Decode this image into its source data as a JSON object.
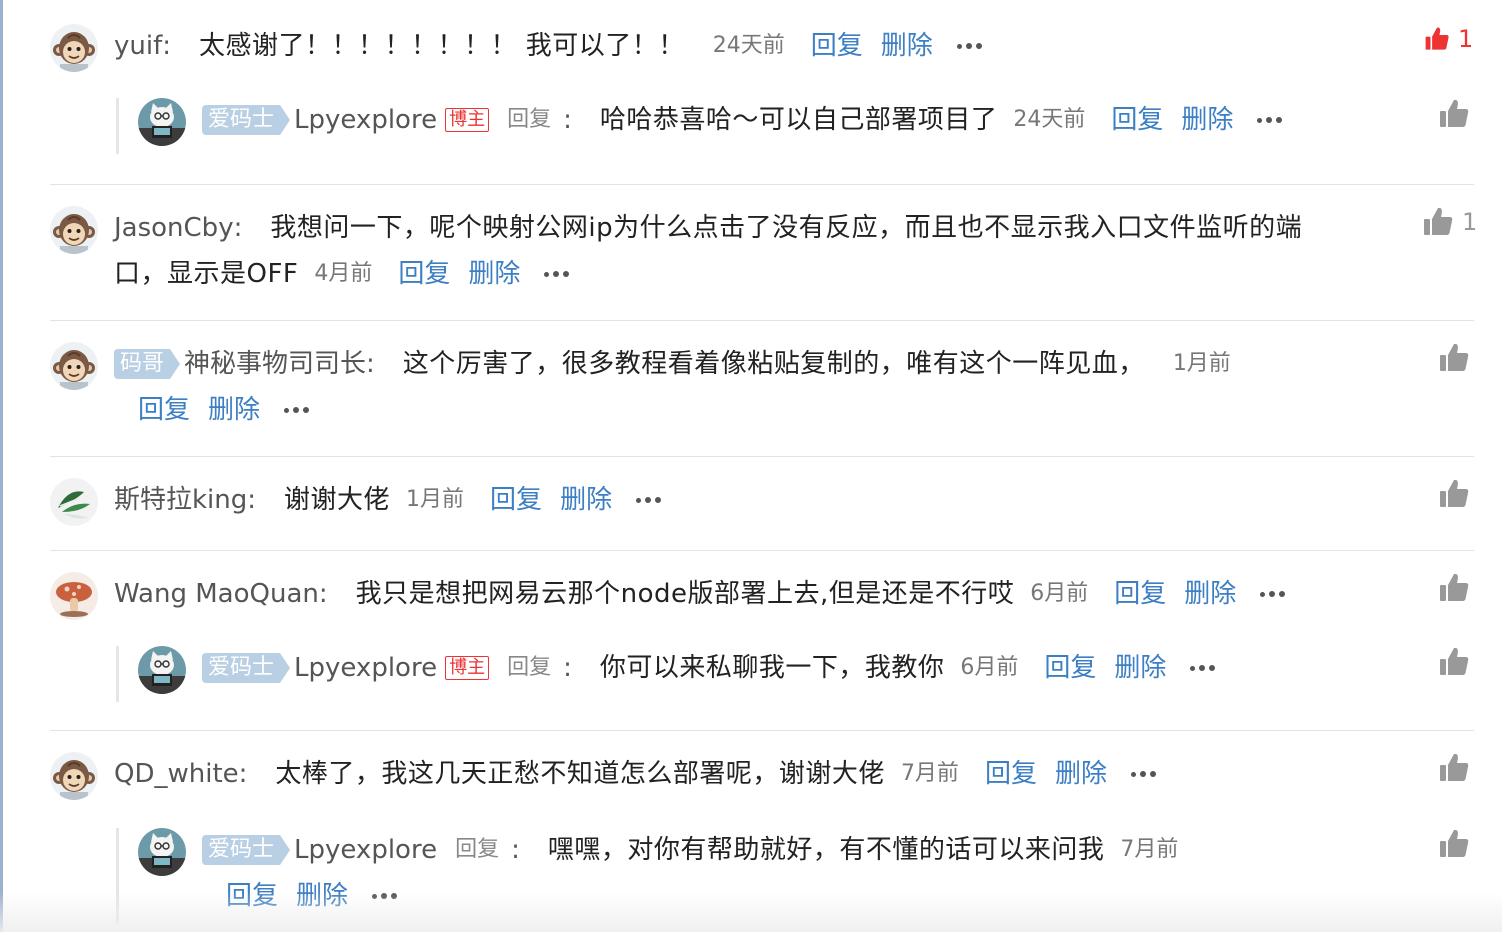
{
  "colors": {
    "link": "#3c7fc4",
    "liked": "#e33333",
    "owner_badge": "#e33333",
    "ai_badge": "#b8cfe4"
  },
  "comments": [
    {
      "user": "yuif",
      "sep": ":",
      "avatar": "monkey-avatar",
      "text": "太感谢了！！！！！！！！ 我可以了！！",
      "time": "24天前",
      "reply_label": "回复",
      "delete_label": "删除",
      "likes": "1",
      "liked": true,
      "replies": [
        {
          "badge": "爱码士",
          "user": "Lpyexplore",
          "owner_badge": "博主",
          "reply_word": "回复",
          "sep": ":",
          "avatar": "cat-avatar",
          "text": "哈哈恭喜哈～可以自己部署项目了",
          "time": "24天前",
          "reply_label": "回复",
          "delete_label": "删除"
        }
      ]
    },
    {
      "user": "JasonCby",
      "sep": ":",
      "avatar": "monkey-avatar",
      "text_line1": "我想问一下，呢个映射公网ip为什么点击了没有反应，而且也不显示我入口文件监听的端",
      "text_line2": "口，显示是OFF",
      "time": "4月前",
      "reply_label": "回复",
      "delete_label": "删除",
      "likes": "1",
      "liked": false
    },
    {
      "badge": "码哥",
      "user": "神秘事物司司长",
      "sep": ":",
      "avatar": "monkey-avatar",
      "text": "这个厉害了，很多教程看着像粘贴复制的，唯有这个一阵见血，",
      "time": "1月前",
      "reply_label": "回复",
      "delete_label": "删除"
    },
    {
      "user": "斯特拉king",
      "sep": ":",
      "avatar": "plant-avatar",
      "text": "谢谢大佬",
      "time": "1月前",
      "reply_label": "回复",
      "delete_label": "删除"
    },
    {
      "user": "Wang MaoQuan",
      "sep": ":",
      "avatar": "mushroom-avatar",
      "text": "我只是想把网易云那个node版部署上去,但是还是不行哎",
      "time": "6月前",
      "reply_label": "回复",
      "delete_label": "删除",
      "replies": [
        {
          "badge": "爱码士",
          "user": "Lpyexplore",
          "owner_badge": "博主",
          "reply_word": "回复",
          "sep": ":",
          "avatar": "cat-avatar",
          "text": "你可以来私聊我一下，我教你",
          "time": "6月前",
          "reply_label": "回复",
          "delete_label": "删除"
        }
      ]
    },
    {
      "user": "QD_white",
      "sep": ":",
      "avatar": "monkey-avatar",
      "text": "太棒了，我这几天正愁不知道怎么部署呢，谢谢大佬",
      "time": "7月前",
      "reply_label": "回复",
      "delete_label": "删除",
      "replies": [
        {
          "badge": "爱码士",
          "user": "Lpyexplore",
          "reply_word": "回复",
          "sep": ":",
          "avatar": "cat-avatar",
          "text": "嘿嘿，对你有帮助就好，有不懂的话可以来问我",
          "time": "7月前",
          "reply_label": "回复",
          "delete_label": "删除"
        }
      ]
    }
  ]
}
